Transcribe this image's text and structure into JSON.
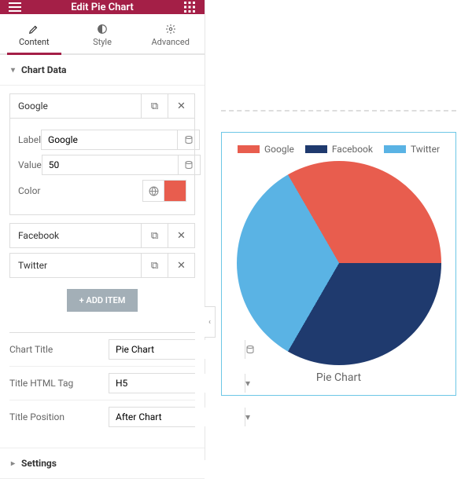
{
  "header": {
    "title": "Edit Pie Chart"
  },
  "tabs": {
    "content": "Content",
    "style": "Style",
    "advanced": "Advanced"
  },
  "sections": {
    "chart_data": "Chart Data",
    "settings": "Settings"
  },
  "items": {
    "google": "Google",
    "facebook": "Facebook",
    "twitter": "Twitter"
  },
  "fields": {
    "label_label": "Label",
    "label_value": "Google",
    "value_label": "Value",
    "value_value": "50",
    "color_label": "Color",
    "color_value": "#e85d4e"
  },
  "add_button": "+   ADD ITEM",
  "options": {
    "chart_title_label": "Chart Title",
    "chart_title_value": "Pie Chart",
    "html_tag_label": "Title HTML Tag",
    "html_tag_value": "H5",
    "position_label": "Title Position",
    "position_value": "After Chart"
  },
  "chart_data": {
    "type": "pie",
    "title": "Pie Chart",
    "series": [
      {
        "name": "Google",
        "value": 50,
        "color": "#e85d4e"
      },
      {
        "name": "Facebook",
        "value": 50,
        "color": "#1f3a6e"
      },
      {
        "name": "Twitter",
        "value": 50,
        "color": "#5ab3e4"
      }
    ],
    "legend_position": "top",
    "title_position": "after"
  }
}
